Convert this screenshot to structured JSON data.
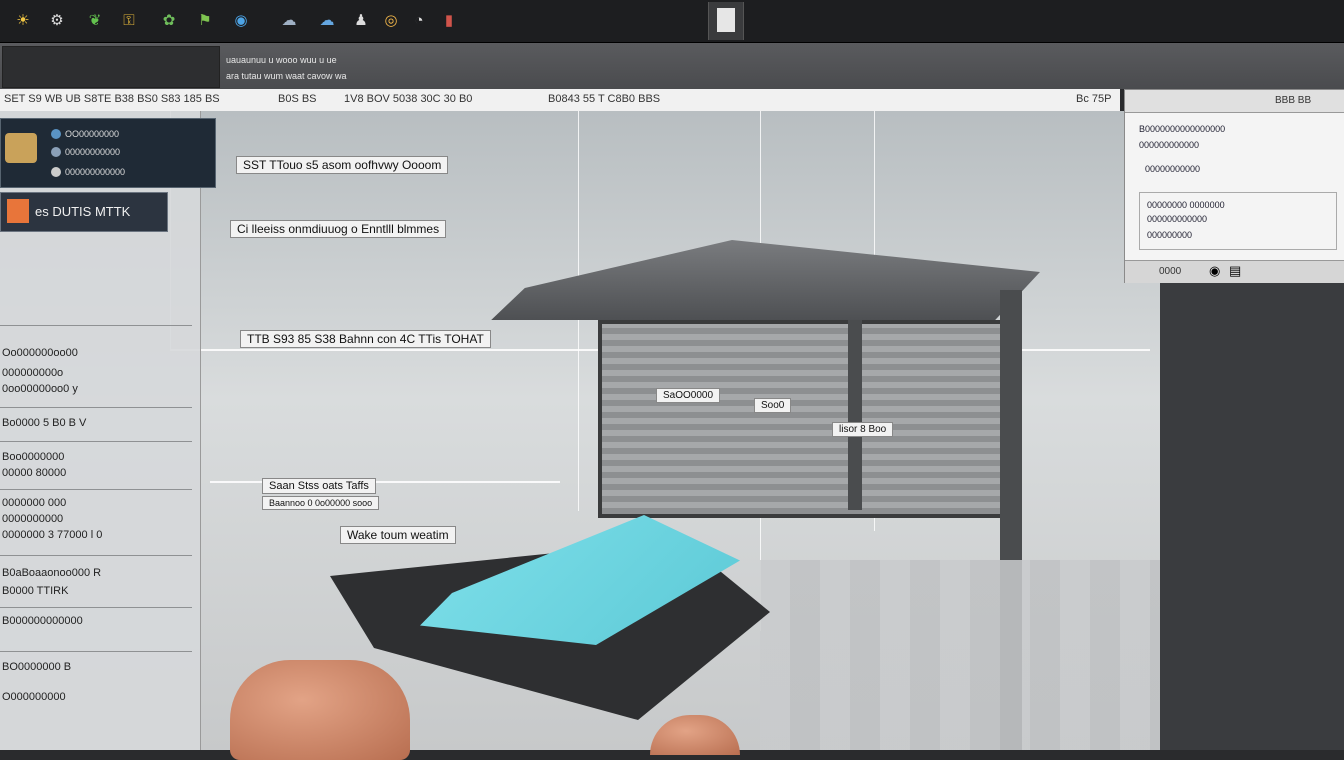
{
  "topbar": {
    "icons": [
      "sun-icon",
      "settings-icon",
      "leaf-icon",
      "key-icon",
      "plant-icon",
      "pin-icon",
      "palette-icon",
      "cloud-icon",
      "cloud-icon",
      "person-icon",
      "globe-icon",
      "clock-icon",
      "bar-icon"
    ],
    "doc_label": ""
  },
  "toolbar2": {
    "line1": "uauaunuu u wooo wuu u ue",
    "line2": "ara tutau wum waat cavow wa"
  },
  "ribbon": {
    "items": [
      "SET S9 WB UB S8TE B38 BS0 S83 185 BS",
      "B0S BS",
      "1V8 BOV 5038 30C 30 B0",
      "B0843 55 T C8B0 BBS"
    ],
    "right_items": [
      "Bc 75P",
      "BBB BB"
    ]
  },
  "layers": {
    "line1": "OO00000000",
    "line2": "00000000000",
    "line3": "000000000000"
  },
  "alert": {
    "label": "es DUTIS MTTK"
  },
  "left_list": [
    "Oo000000oo00",
    "000000000o",
    "0oo00000oo0  y",
    "Bo0000 5  B0 B  V",
    "Boo0000000",
    "00000  80000",
    "0000000 000",
    "0000000000",
    "0000000 3  77000  l 0",
    "B0aBoaaonoo000 R",
    "B0000  TTIRK",
    "B000000000000",
    "BO0000000 B",
    "O000000000"
  ],
  "annotations": {
    "a1": "SST TTouo s5 asom oofhvwy Oooom",
    "a2": "Ci lleeiss onmdiuuog o Enntlll blmmes",
    "a3": "TTB S93 85 S38 Bahnn con 4C TTis TOHAT",
    "a4": "SaOO0000",
    "a5": "Soo0",
    "a6": "lisor 8 Boo",
    "a7": "Saan Stss oats Taffs",
    "a8": "Baannoo 0 0o00000 sooo",
    "a9": "Wake toum weatim"
  },
  "props": {
    "lines": [
      "B0000000000000000",
      "000000000000",
      "00000000000",
      "00000000 0000000",
      "000000000000",
      "000000000"
    ],
    "footer_icons": [
      "link-icon",
      "bulb-icon",
      "doc-icon"
    ],
    "footer_label": "0000"
  }
}
